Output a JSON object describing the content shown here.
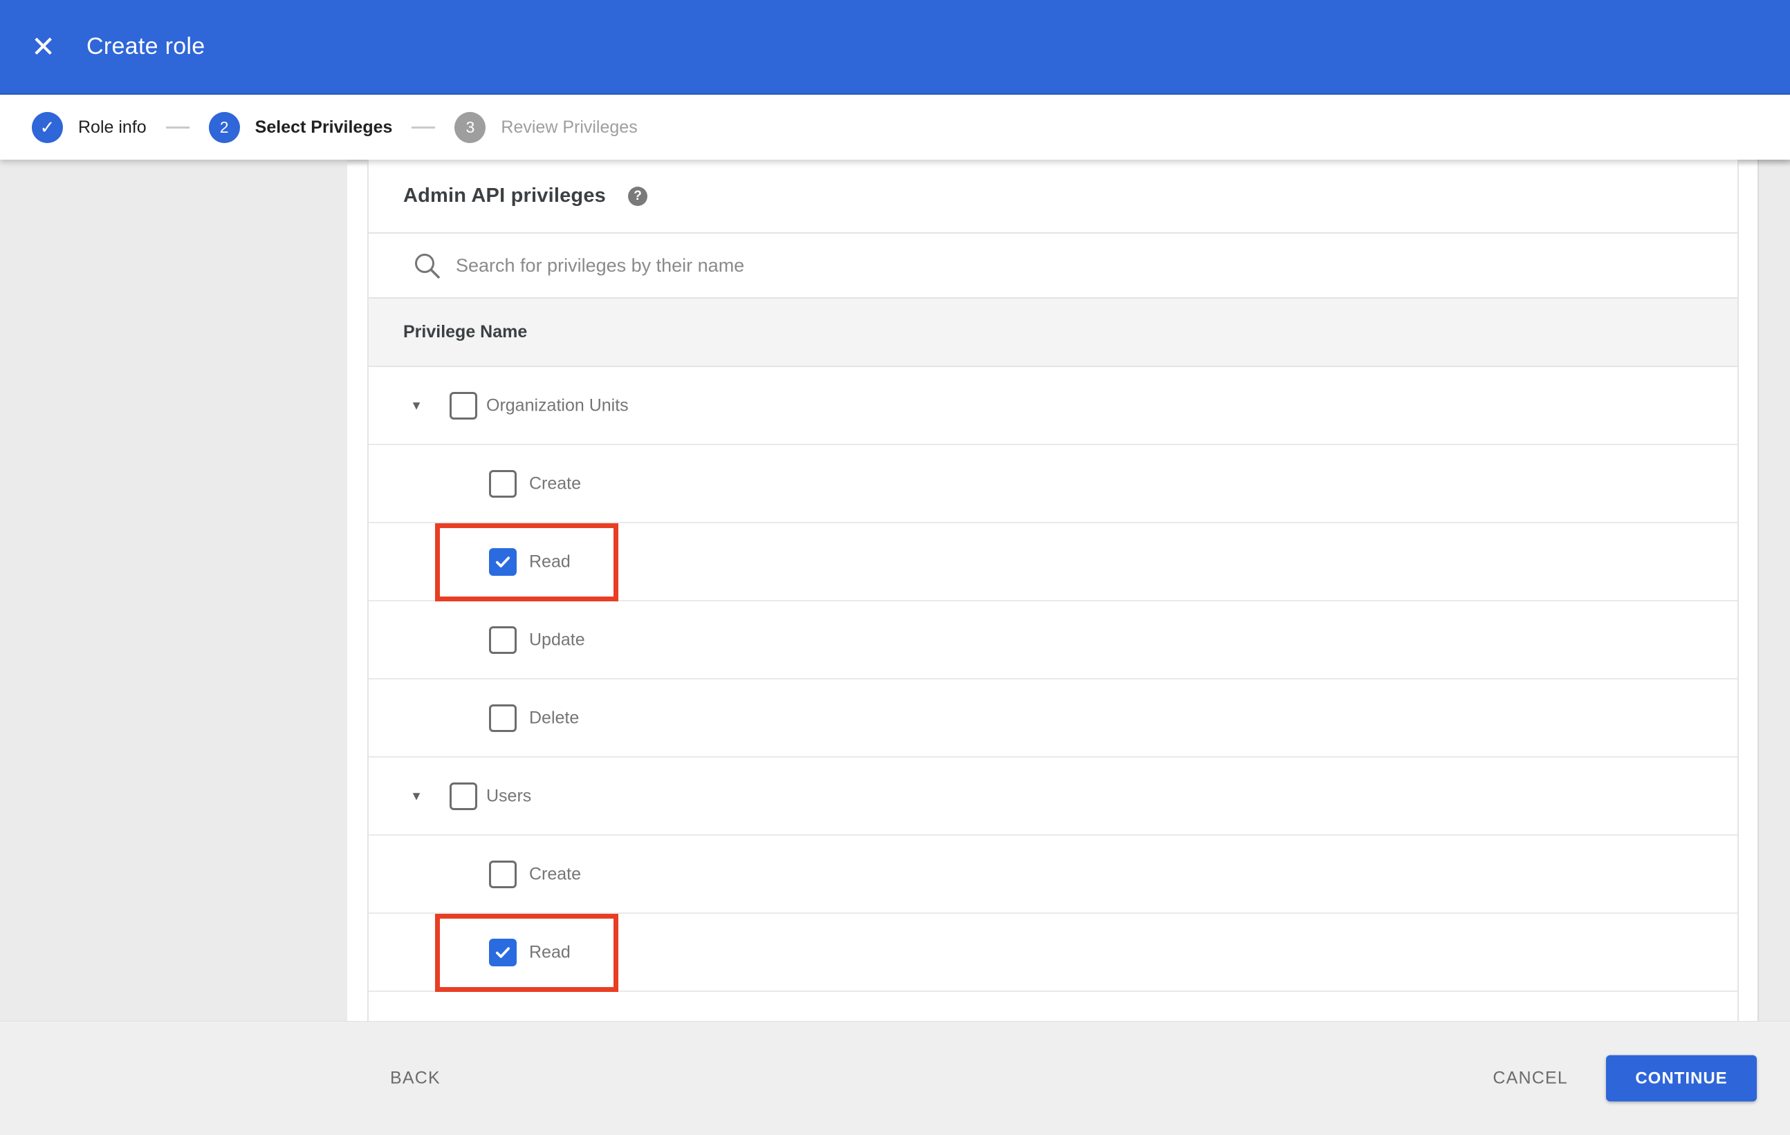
{
  "header": {
    "title": "Create role"
  },
  "icons": {
    "close_glyph": "✕",
    "check_glyph": "✓",
    "chevron_glyph": "▼",
    "help_glyph": "?"
  },
  "stepper": {
    "steps": [
      {
        "number": "1",
        "label": "Role info",
        "state": "complete"
      },
      {
        "number": "2",
        "label": "Select Privileges",
        "state": "active"
      },
      {
        "number": "3",
        "label": "Review Privileges",
        "state": "upcoming"
      }
    ]
  },
  "content": {
    "section_title": "Admin API privileges",
    "search": {
      "placeholder": "Search for privileges by their name",
      "value": ""
    },
    "table": {
      "header": "Privilege Name",
      "rows": [
        {
          "label": "Organization Units",
          "level": "parent",
          "expanded": true,
          "checked": false,
          "highlighted": false
        },
        {
          "label": "Create",
          "level": "child",
          "checked": false,
          "highlighted": false
        },
        {
          "label": "Read",
          "level": "child",
          "checked": true,
          "highlighted": true
        },
        {
          "label": "Update",
          "level": "child",
          "checked": false,
          "highlighted": false
        },
        {
          "label": "Delete",
          "level": "child",
          "checked": false,
          "highlighted": false
        },
        {
          "label": "Users",
          "level": "parent",
          "expanded": true,
          "checked": false,
          "highlighted": false
        },
        {
          "label": "Create",
          "level": "child",
          "checked": false,
          "highlighted": false
        },
        {
          "label": "Read",
          "level": "child",
          "checked": true,
          "highlighted": true
        }
      ]
    }
  },
  "footer": {
    "back_label": "BACK",
    "cancel_label": "CANCEL",
    "continue_label": "CONTINUE"
  },
  "colors": {
    "appbar_blue": "#2f66d8",
    "checkbox_blue": "#2a6be0",
    "continue_blue": "#2e65d9",
    "highlight_red": "#e83e24",
    "page_gray": "#ebebeb",
    "footer_gray": "#efefef",
    "table_header_gray": "#f4f4f4"
  }
}
